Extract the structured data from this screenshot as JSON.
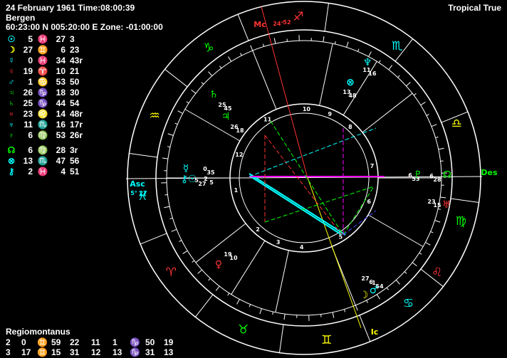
{
  "header": {
    "title": "24 February 1961 Time:08:00:39",
    "place": "Bergen",
    "coords": "60:23:00 N 005:20:00 E Zone: -01:00:00",
    "mode": "Tropical True"
  },
  "planets": [
    {
      "name": "Sun",
      "glyph": "☉",
      "color": "#00ffff",
      "deg": "5",
      "sign": "♓",
      "sign_color": "#00ffff",
      "min": "27",
      "sec": "3"
    },
    {
      "name": "Moon",
      "glyph": "☽",
      "color": "#ffff00",
      "deg": "27",
      "sign": "♊",
      "sign_color": "#ffff00",
      "min": "6",
      "sec": "23"
    },
    {
      "name": "Mercury",
      "glyph": "☿",
      "color": "#00ffff",
      "deg": "0",
      "sign": "♓",
      "sign_color": "#00ffff",
      "min": "34",
      "sec": "43r"
    },
    {
      "name": "Venus",
      "glyph": "♀",
      "color": "#ff3333",
      "deg": "19",
      "sign": "♈",
      "sign_color": "#ff3333",
      "min": "10",
      "sec": "21"
    },
    {
      "name": "Mars",
      "glyph": "♂",
      "color": "#00ffff",
      "deg": "1",
      "sign": "♋",
      "sign_color": "#00ffff",
      "min": "53",
      "sec": "50"
    },
    {
      "name": "Jupiter",
      "glyph": "♃",
      "color": "#00ff00",
      "deg": "26",
      "sign": "♑",
      "sign_color": "#00ff00",
      "min": "18",
      "sec": "30"
    },
    {
      "name": "Saturn",
      "glyph": "♄",
      "color": "#00ff00",
      "deg": "25",
      "sign": "♑",
      "sign_color": "#00ff00",
      "min": "44",
      "sec": "54"
    },
    {
      "name": "Uranus",
      "glyph": "♅",
      "color": "#ff3333",
      "deg": "23",
      "sign": "♌",
      "sign_color": "#ff3333",
      "min": "14",
      "sec": "48r"
    },
    {
      "name": "Neptune",
      "glyph": "♆",
      "color": "#00ffff",
      "deg": "11",
      "sign": "♏",
      "sign_color": "#00ffff",
      "min": "16",
      "sec": "17r"
    },
    {
      "name": "Pluto",
      "glyph": "♇",
      "color": "#00ff00",
      "deg": "6",
      "sign": "♍",
      "sign_color": "#00ff00",
      "min": "53",
      "sec": "26r"
    },
    {
      "gap": true
    },
    {
      "name": "Node",
      "glyph": "☊",
      "color": "#00ff00",
      "deg": "6",
      "sign": "♍",
      "sign_color": "#00ff00",
      "min": "28",
      "sec": "3r"
    },
    {
      "name": "Part of Fortune",
      "glyph": "⊗",
      "color": "#00ffff",
      "deg": "13",
      "sign": "♏",
      "sign_color": "#00ffff",
      "min": "47",
      "sec": "56"
    },
    {
      "name": "Chiron",
      "glyph": "⚷",
      "color": "#00ffff",
      "deg": "2",
      "sign": "♓",
      "sign_color": "#00ffff",
      "min": "4",
      "sec": "51"
    }
  ],
  "houses": {
    "title": "Regiomontanus",
    "rows": [
      [
        {
          "t": "2"
        },
        {
          "t": "0"
        },
        {
          "t": "♊",
          "c": "#ffff00"
        },
        {
          "t": "59"
        },
        {
          "t": "22"
        },
        {
          "t": "11"
        },
        {
          "t": "1"
        },
        {
          "t": "♑",
          "c": "#00ff00"
        },
        {
          "t": "50"
        },
        {
          "t": "19"
        }
      ],
      [
        {
          "t": "3"
        },
        {
          "t": "17"
        },
        {
          "t": "♊",
          "c": "#ffff00"
        },
        {
          "t": "15"
        },
        {
          "t": "31"
        },
        {
          "t": "12"
        },
        {
          "t": "13"
        },
        {
          "t": "♑",
          "c": "#00ff00"
        },
        {
          "t": "31"
        },
        {
          "t": "13"
        }
      ]
    ]
  },
  "chart": {
    "mc": {
      "label": "Mc",
      "deg": "24°",
      "min": "52"
    },
    "asc": {
      "label": "Asc",
      "deg": "5°",
      "min": "27"
    },
    "des": {
      "label": "Des"
    },
    "ic": {
      "label": "Ic"
    },
    "zodiac": [
      {
        "g": "♍",
        "c": "#00ff00",
        "a": "345"
      },
      {
        "g": "♎",
        "c": "#ffff00",
        "a": "20"
      },
      {
        "g": "♏",
        "c": "#00ffff",
        "a": "55"
      },
      {
        "g": "♐",
        "c": "#ff3333",
        "a": "92"
      },
      {
        "g": "♑",
        "c": "#00ff00",
        "a": "126"
      },
      {
        "g": "♒",
        "c": "#ffff00",
        "a": "157"
      },
      {
        "g": "♓",
        "c": "#00ffff",
        "a": "186"
      },
      {
        "g": "♈",
        "c": "#ff3333",
        "a": "215"
      },
      {
        "g": "♉",
        "c": "#00ff00",
        "a": "248"
      },
      {
        "g": "♊",
        "c": "#ffff00",
        "a": "278"
      },
      {
        "g": "♋",
        "c": "#00ffff",
        "a": "310"
      },
      {
        "g": "♌",
        "c": "#ff3333",
        "a": "325"
      }
    ],
    "house_numbers": [
      "1",
      "2",
      "3",
      "4",
      "5",
      "6",
      "7",
      "8",
      "9",
      "10",
      "11",
      "12"
    ],
    "planet_marks": [
      {
        "g": "♆",
        "c": "#00ffff",
        "d": "11",
        "m": "16"
      },
      {
        "g": "⊗",
        "c": "#00ffff",
        "d": "13",
        "m": "48"
      },
      {
        "g": "♄",
        "c": "#00ff00",
        "d": "25",
        "m": "45"
      },
      {
        "g": "♃",
        "c": "#00ff00",
        "d": "26",
        "m": "18"
      },
      {
        "g": "☿",
        "c": "#00ffff",
        "d": "0",
        "m": "35"
      },
      {
        "g": "⚷",
        "c": "#00ffff",
        "d": "2",
        "m": "5"
      },
      {
        "g": "☉",
        "c": "#00ffff",
        "d": "5",
        "m": "27"
      },
      {
        "g": "♀",
        "c": "#ff3333",
        "d": "19",
        "m": "10"
      },
      {
        "g": "☽",
        "c": "#ffff00",
        "d": "27",
        "m": "6"
      },
      {
        "g": "♂",
        "c": "#00ffff",
        "d": "1",
        "m": "54"
      },
      {
        "g": "♇",
        "c": "#00ff00",
        "d": "6",
        "m": "53"
      },
      {
        "g": "☊",
        "c": "#00ff00",
        "d": "6",
        "m": "28"
      },
      {
        "g": "♅",
        "c": "#ff3333",
        "d": "23",
        "m": "15"
      }
    ]
  }
}
